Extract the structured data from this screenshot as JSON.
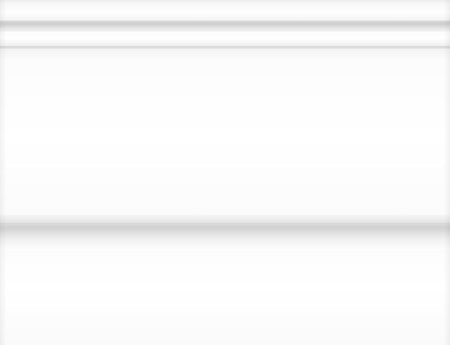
{
  "image": {
    "subject": "white-glazed-skirting-tile",
    "colors": {
      "glaze": "#fcfcfc",
      "groove_shadow": "#d2d2d2",
      "edge_shadow": "#ededed"
    }
  }
}
